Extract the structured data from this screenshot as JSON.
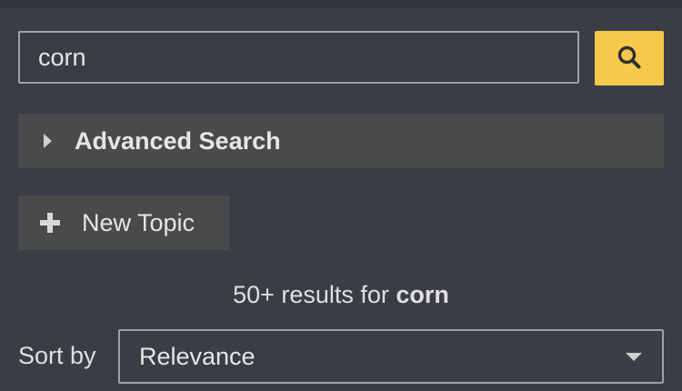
{
  "search": {
    "value": "corn",
    "button_icon": "search-icon"
  },
  "advanced_search": {
    "label": "Advanced Search",
    "icon": "caret-right-icon"
  },
  "new_topic": {
    "label": "New Topic",
    "icon": "plus-icon"
  },
  "results": {
    "prefix": "50+ results for ",
    "query": "corn"
  },
  "sort": {
    "label": "Sort by",
    "selected": "Relevance",
    "icon": "chevron-down-icon"
  },
  "colors": {
    "background": "#3a3d44",
    "accent": "#f5c94c",
    "panel": "#4a4a4c",
    "border": "#9ea1a6"
  }
}
